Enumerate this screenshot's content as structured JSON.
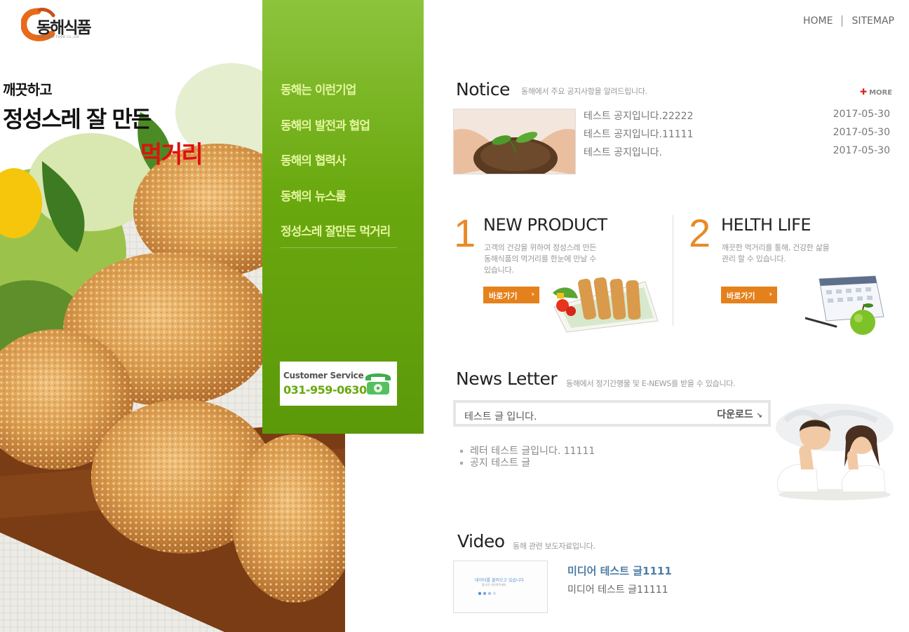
{
  "logo": {
    "name": "동해식품",
    "sub": "DONGHAE FOOD Co.,Ltd"
  },
  "hero": {
    "line1": "깨끗하고",
    "line2": "정성스레 잘 만든",
    "line3": "먹거리"
  },
  "nav": {
    "items": [
      {
        "label": "동해는 이런기업"
      },
      {
        "label": "동해의 발전과 협업"
      },
      {
        "label": "동해의 협력사"
      },
      {
        "label": "동해의 뉴스룸"
      },
      {
        "label": "정성스레 잘만든 먹거리"
      }
    ]
  },
  "customer_service": {
    "title": "Customer Service",
    "phone": "031-959-0630"
  },
  "top_links": {
    "home": "HOME",
    "sitemap": "SITEMAP"
  },
  "notice": {
    "title": "Notice",
    "subtitle": "동해에서 주요 공지사항을 알려드립니다.",
    "more": "MORE",
    "items": [
      {
        "title": "테스트 공지입니다.22222",
        "date": "2017-05-30"
      },
      {
        "title": "테스트 공지입니다.11111",
        "date": "2017-05-30"
      },
      {
        "title": "테스트 공지입니다.",
        "date": "2017-05-30"
      }
    ]
  },
  "products": [
    {
      "number": "1",
      "title": "NEW PRODUCT",
      "desc": [
        "고객의 건강을 위하여 정성스레 만든",
        "동해식품의 먹거리를 한눈에 만날 수",
        "있습니다."
      ],
      "button": "바로가기"
    },
    {
      "number": "2",
      "title": "HELTH LIFE",
      "desc": [
        "깨끗한 먹거리를 통해, 건강한 삶을",
        "관리 할 수 있습니다."
      ],
      "button": "바로가기"
    }
  ],
  "newsletter": {
    "title": "News Letter",
    "subtitle": "동해에서 정기간행물 및 E-NEWS를 받을 수 있습니다.",
    "featured": "테스트 글 입니다.",
    "download": "다운로드",
    "items": [
      "레터 테스트 글입니다. 11111",
      "공지 테스트 글"
    ]
  },
  "video": {
    "title": "Video",
    "subtitle": "동해 관련 보도자료입니다.",
    "thumb_line1": "데이터를 불러오고 있습니다",
    "thumb_line2": "잠시만 기다려주세요",
    "item_title": "미디어 테스트 글1111",
    "item_desc": "미디어 테스트 글11111"
  },
  "colors": {
    "nav_green": "#6aa80f",
    "accent_orange": "#e5811c",
    "notice_red": "#d8261f",
    "hero_red": "#e01010"
  }
}
